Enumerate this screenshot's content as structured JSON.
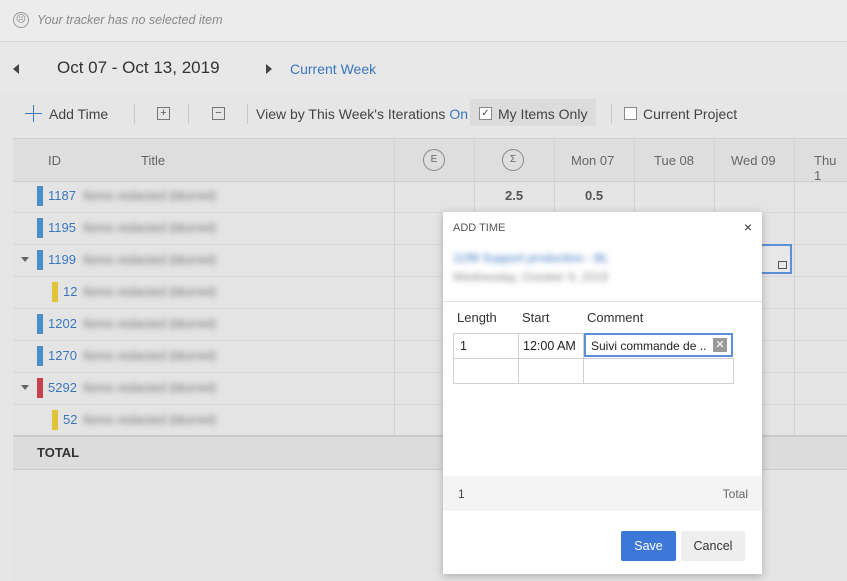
{
  "tracker_bar": {
    "message": "Your tracker has no selected item",
    "icon": "sad-face-icon"
  },
  "week_nav": {
    "range": "Oct 07 - Oct 13, 2019",
    "current_week_link": "Current Week"
  },
  "toolbar": {
    "add_time": "Add Time",
    "view_by_label": "View by This Week's Iterations",
    "view_by_state": "On",
    "my_items_only": "My Items Only",
    "my_items_checked": true,
    "current_project": "Current Project",
    "current_project_checked": false
  },
  "grid": {
    "headers": {
      "id": "ID",
      "title": "Title",
      "estimate_symbol": "E",
      "sum_symbol": "Σ",
      "days": [
        "Mon 07",
        "Tue 08",
        "Wed 09",
        "Thu 1"
      ]
    },
    "rows": [
      {
        "id": "1187",
        "title": "Items redacted (blurred)",
        "color": "#4a90c8",
        "sum": "2.5",
        "mon": "0.5"
      },
      {
        "id": "1195",
        "title": "Items redacted (blurred)",
        "color": "#4a90c8",
        "sum": "",
        "mon": ""
      },
      {
        "id": "1199",
        "title": "Items redacted (blurred)",
        "color": "#4a90c8",
        "sum": "",
        "mon": ""
      },
      {
        "id": "12",
        "title": "Items redacted (blurred)",
        "color": "#e1c33a",
        "sum": "",
        "mon": ""
      },
      {
        "id": "1202",
        "title": "Items redacted (blurred)",
        "color": "#4a90c8",
        "sum": "",
        "mon": ""
      },
      {
        "id": "1270",
        "title": "Items redacted (blurred)",
        "color": "#4a90c8",
        "sum": "",
        "mon": ""
      },
      {
        "id": "5292",
        "title": "Items redacted (blurred)",
        "color": "#c8404a",
        "sum": "",
        "mon": ""
      },
      {
        "id": "52",
        "title": "Items redacted (blurred)",
        "color": "#e1c33a",
        "sum": "",
        "mon": ""
      }
    ],
    "total_label": "TOTAL"
  },
  "dialog": {
    "title": "ADD TIME",
    "item_line": "1199 Support production - BL",
    "date_line": "Wednesday, October 9, 2019",
    "columns": {
      "length": "Length",
      "start": "Start",
      "comment": "Comment"
    },
    "entry": {
      "length": "1",
      "start": "12:00 AM",
      "comment": "Suivi commande de ..."
    },
    "footer_total_value": "1",
    "footer_total_label": "Total",
    "save": "Save",
    "cancel": "Cancel",
    "close": "×"
  }
}
